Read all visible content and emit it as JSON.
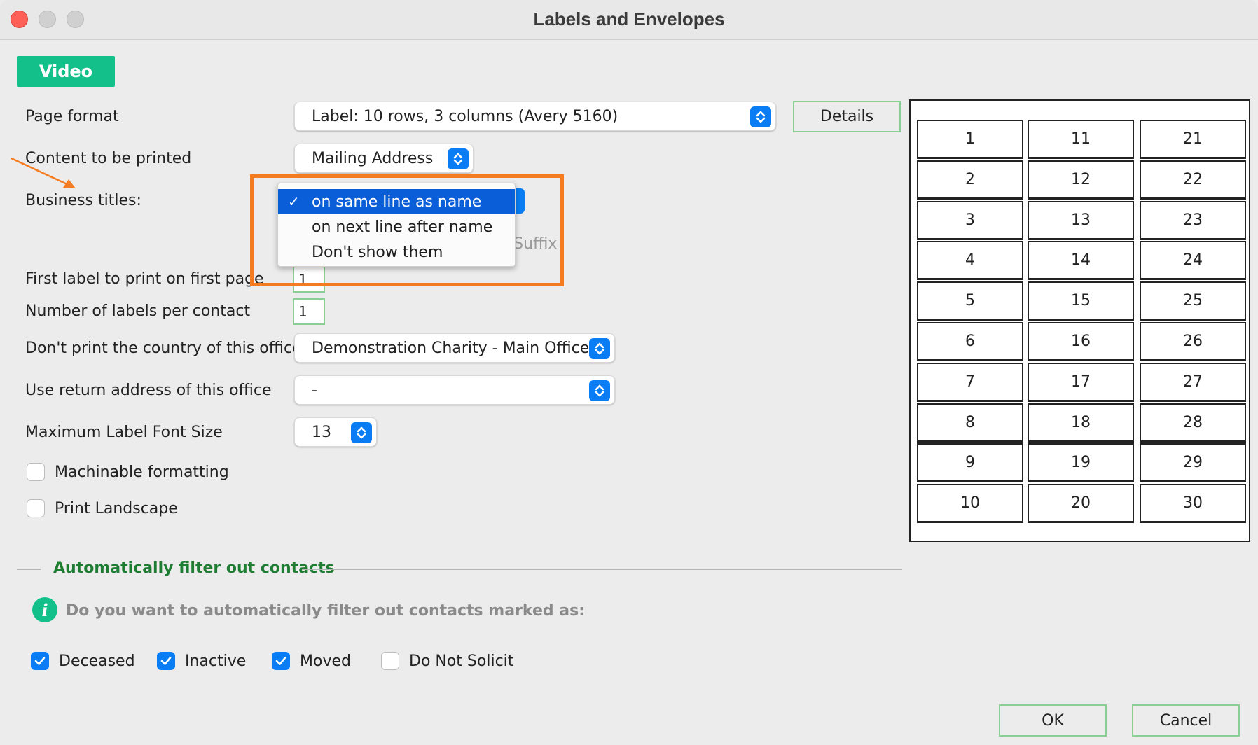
{
  "window": {
    "title": "Labels and Envelopes"
  },
  "video_button": "Video",
  "form": {
    "page_format": {
      "label": "Page format",
      "value": "Label: 10 rows, 3 columns (Avery 5160)"
    },
    "details_button": "Details",
    "content_to_print": {
      "label": "Content to be printed",
      "value": "Mailing Address"
    },
    "business_titles": {
      "label": "Business titles:",
      "options": [
        "on same line as name",
        "on next line after name",
        "Don't show them"
      ],
      "selected_check": "✓"
    },
    "hidden_behind": {
      "text_right": "Exclude Suffix"
    },
    "first_label": {
      "label": "First label to print on first page",
      "value": "1"
    },
    "labels_per_contact": {
      "label": "Number of labels per contact",
      "value": "1"
    },
    "country_office": {
      "label": "Don't print the country of this office",
      "value": "Demonstration Charity - Main Office"
    },
    "return_address": {
      "label": "Use return address of this office",
      "value": "-"
    },
    "max_font": {
      "label": "Maximum Label Font Size",
      "value": "13"
    },
    "machinable": {
      "label": "Machinable formatting",
      "checked": false
    },
    "landscape": {
      "label": "Print Landscape",
      "checked": false
    }
  },
  "filter": {
    "section_title": "Automatically filter out contacts",
    "info_icon": "i",
    "info_text": "Do you want to automatically filter out contacts marked as:",
    "options": [
      {
        "label": "Deceased",
        "checked": true
      },
      {
        "label": "Inactive",
        "checked": true
      },
      {
        "label": "Moved",
        "checked": true
      },
      {
        "label": "Do Not Solicit",
        "checked": false
      }
    ]
  },
  "preview": {
    "columns": [
      [
        "1",
        "2",
        "3",
        "4",
        "5",
        "6",
        "7",
        "8",
        "9",
        "10"
      ],
      [
        "11",
        "12",
        "13",
        "14",
        "15",
        "16",
        "17",
        "18",
        "19",
        "20"
      ],
      [
        "21",
        "22",
        "23",
        "24",
        "25",
        "26",
        "27",
        "28",
        "29",
        "30"
      ]
    ]
  },
  "buttons": {
    "ok": "OK",
    "cancel": "Cancel"
  },
  "colors": {
    "accent": "#0a7df5",
    "highlight": "#f47b20",
    "video": "#14c08a",
    "section": "#1e7d33"
  }
}
